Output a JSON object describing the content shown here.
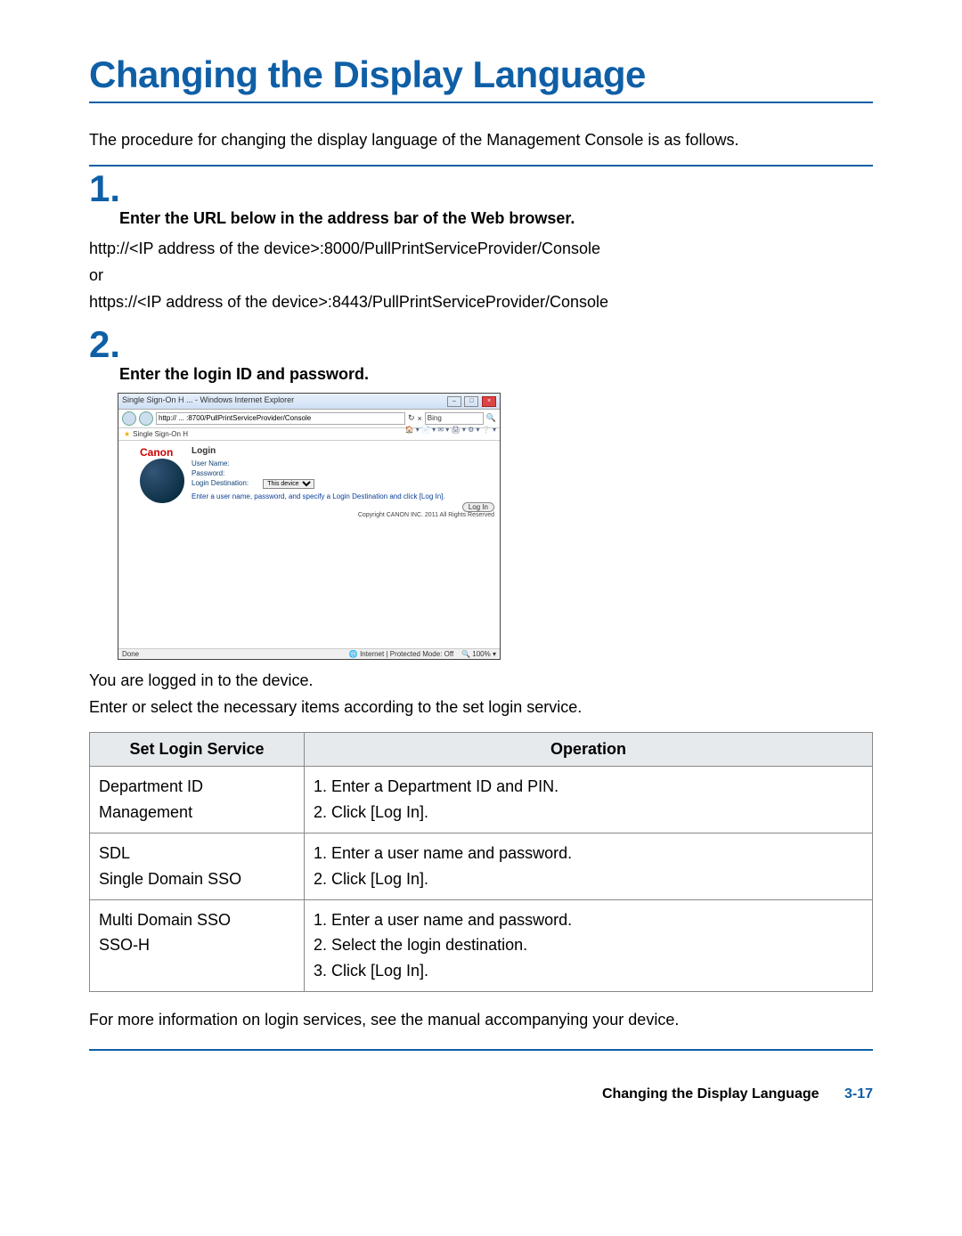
{
  "heading": "Changing the Display Language",
  "intro": "The procedure for changing the display language of the Management Console is as follows.",
  "step1": {
    "num": "1.",
    "title": "Enter the URL below in the address bar of the Web browser.",
    "line1": "http://<IP address of the device>:8000/PullPrintServiceProvider/Console",
    "line2": "or",
    "line3": "https://<IP address of the device>:8443/PullPrintServiceProvider/Console"
  },
  "step2": {
    "num": "2.",
    "title": "Enter the login ID and password.",
    "after1": "You are logged in to the device.",
    "after2": "Enter or select the necessary items according to the set login service."
  },
  "screenshot": {
    "window_title": "Single Sign-On H ... - Windows Internet Explorer",
    "url": "http:// ... :8700/PullPrintServiceProvider/Console",
    "search_engine": "Bing",
    "fav_label": "Single Sign-On H",
    "brand": "Canon",
    "login_heading": "Login",
    "username_label": "User Name:",
    "password_label": "Password:",
    "dest_label": "Login Destination:",
    "dest_value": "This device",
    "hint": "Enter a user name, password, and specify a Login Destination and click [Log In].",
    "login_button": "Log In",
    "copyright": "Copyright CANON INC. 2011 All Rights Reserved",
    "status_done": "Done",
    "status_zone": "Internet | Protected Mode: Off",
    "status_zoom": "100%"
  },
  "table": {
    "head1": "Set Login Service",
    "head2": "Operation",
    "rows": [
      {
        "service_a": "Department ID Management",
        "service_b": "",
        "op1": "1. Enter a Department ID and PIN.",
        "op2": "2. Click [Log In].",
        "op3": ""
      },
      {
        "service_a": "SDL",
        "service_b": "Single Domain SSO",
        "op1": "1. Enter a user name and password.",
        "op2": "2. Click [Log In].",
        "op3": ""
      },
      {
        "service_a": "Multi Domain SSO",
        "service_b": "SSO-H",
        "op1": "1. Enter a user name and password.",
        "op2": "2. Select the login destination.",
        "op3": "3. Click [Log In]."
      }
    ]
  },
  "closing": "For more information on login services, see the manual accompanying your device.",
  "footer_title": "Changing the Display Language",
  "footer_page": "3-17"
}
